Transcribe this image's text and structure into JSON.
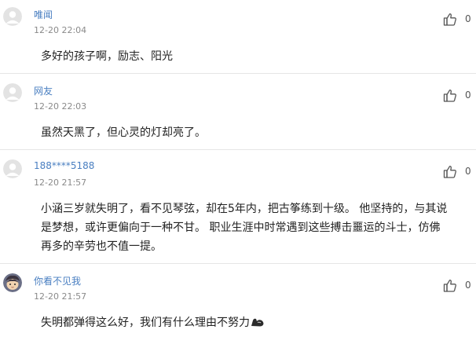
{
  "comments": [
    {
      "user": "唯闻",
      "time": "12-20 22:04",
      "likes": "0",
      "lines": [
        "多好的孩子啊，励志、阳光"
      ],
      "avatar_icon": "default-avatar-icon"
    },
    {
      "user": "网友",
      "time": "12-20 22:03",
      "likes": "0",
      "lines": [
        "虽然天黑了，但心灵的灯却亮了。"
      ],
      "avatar_icon": "default-avatar-icon"
    },
    {
      "user": "188****5188",
      "time": "12-20 21:57",
      "likes": "0",
      "lines": [
        "小涵三岁就失明了，看不见琴弦，却在5年内，把古筝练到十级。 他坚持的，与其说",
        "是梦想，或许更偏向于一种不甘。 职业生涯中时常遇到这些搏击噩运的斗士，仿佛",
        "再多的辛劳也不值一提。"
      ],
      "avatar_icon": "default-avatar-icon"
    },
    {
      "user": "你看不见我",
      "time": "12-20 21:57",
      "likes": "0",
      "lines": [
        "失明都弹得这么好，我们有什么理由不努力"
      ],
      "avatar_icon": "cartoon-avatar-icon",
      "trailing_icon": "flexed-biceps-icon"
    }
  ],
  "colors": {
    "username": "#4a7fc1",
    "timestamp": "#8a8a8a",
    "text": "#222222",
    "divider": "#e6e6e6"
  }
}
